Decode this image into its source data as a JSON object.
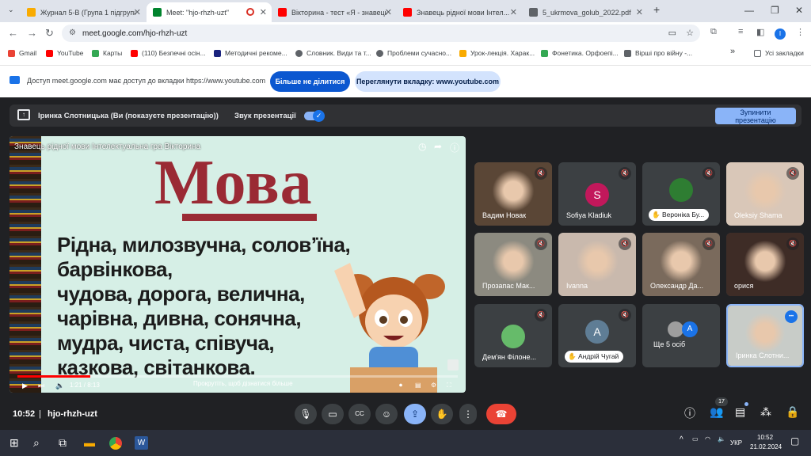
{
  "browser": {
    "tabs": [
      {
        "title": "Журнал 5-В (Група 1 підгрупа)",
        "color": "#f9ab00"
      },
      {
        "title": "Meet: \"hjo-rhzh-uzt\"",
        "color": "#00832d",
        "active": true
      },
      {
        "title": "Вікторина - тест «Я - знавець»",
        "color": "#ff0000"
      },
      {
        "title": "Знавець рідної мови Інтел...",
        "color": "#ff0000"
      },
      {
        "title": "5_ukrmova_golub_2022.pdf",
        "color": "#5f6368"
      }
    ],
    "new_tab": "+",
    "url": "meet.google.com/hjo-rhzh-uzt",
    "bookmarks": [
      {
        "label": "Gmail",
        "color": "#ea4335"
      },
      {
        "label": "YouTube",
        "color": "#ff0000"
      },
      {
        "label": "Карты",
        "color": "#34a853"
      },
      {
        "label": "(110) Безпечні осін...",
        "color": "#ff0000"
      },
      {
        "label": "Методичні рекоме...",
        "color": "#1a237e"
      },
      {
        "label": "Словник. Види та т...",
        "color": "#5f6368"
      },
      {
        "label": "Проблеми сучасно...",
        "color": "#5f6368"
      },
      {
        "label": "Урок-лекція. Харак...",
        "color": "#f9ab00"
      },
      {
        "label": "Фонетика. Орфоепі...",
        "color": "#34a853"
      },
      {
        "label": "Вірші про війну -...",
        "color": "#5f6368"
      }
    ],
    "more_bookmarks": "»",
    "all_bookmarks": "Усі закладки",
    "profile_letter": "І"
  },
  "infobar": {
    "message": "Доступ до meet.google.com має доступ до вкладки https://www.youtube.com",
    "message_short": "Доступ meet.google.com має доступ до вкладки https://www.youtube.com",
    "stop_sharing": "Більше не ділитися",
    "view_tab": "Переглянути вкладку: www.youtube.com"
  },
  "presentation_bar": {
    "presenter": "Іринка Слотницька (Ви (показуєте презентацію))",
    "sound_label": "Звук презентації",
    "sound_on": true,
    "stop_line1": "Зупинити",
    "stop_line2": "презентацію"
  },
  "video": {
    "title": "Знавець рідної мови Інтелектуальна гра Вікторина",
    "heading": "Мова",
    "poem_lines": [
      "Рідна, милозвучна, солов’їна, барвінкова,",
      "чудова, дорога, велична,",
      "чарівна, дивна, сонячна,",
      "мудра, чиста, співуча,",
      "казкова, світанкова."
    ],
    "time": "1:21 / 8:13",
    "progress": 0.165,
    "scroll_hint": "Прокрутіть, щоб дізнатися більше"
  },
  "participants": [
    {
      "name": "Вадим Новак",
      "type": "photo",
      "bg": "#5a4636"
    },
    {
      "name": "Sofiya Kladiuk",
      "type": "avatar",
      "letter": "S",
      "avatar_color": "#c2185b"
    },
    {
      "name": "Вероніка Бу...",
      "type": "avatar-pill",
      "avatar_color": "#2e7d32"
    },
    {
      "name": "Oleksiy Shama",
      "type": "photo",
      "bg": "#d9c7b8"
    },
    {
      "name": "Прозапас Мак...",
      "type": "photo",
      "bg": "#8c8a80"
    },
    {
      "name": "Ivanna",
      "type": "photo",
      "bg": "#c9b9ad"
    },
    {
      "name": "Олександр Да...",
      "type": "photo",
      "bg": "#7a6a5c"
    },
    {
      "name": "орися",
      "type": "photo",
      "bg": "#3e2c26"
    },
    {
      "name": "Дем'ян Філоне...",
      "type": "avatar",
      "letter": "",
      "avatar_color": "#66bb6a"
    },
    {
      "name": "Андрій Чугай",
      "type": "avatar-pill",
      "letter": "A",
      "avatar_color": "#5f7d95"
    },
    {
      "name": "Ще 5 осіб",
      "type": "more"
    },
    {
      "name": "Іринка Слотни...",
      "type": "photo-self",
      "bg": "#c8ccc8"
    }
  ],
  "bottom": {
    "time": "10:52",
    "meeting_code": "hjo-rhzh-uzt",
    "participants_count": "17"
  },
  "taskbar": {
    "lang": "УКР",
    "time": "10:52",
    "date": "21.02.2024"
  }
}
